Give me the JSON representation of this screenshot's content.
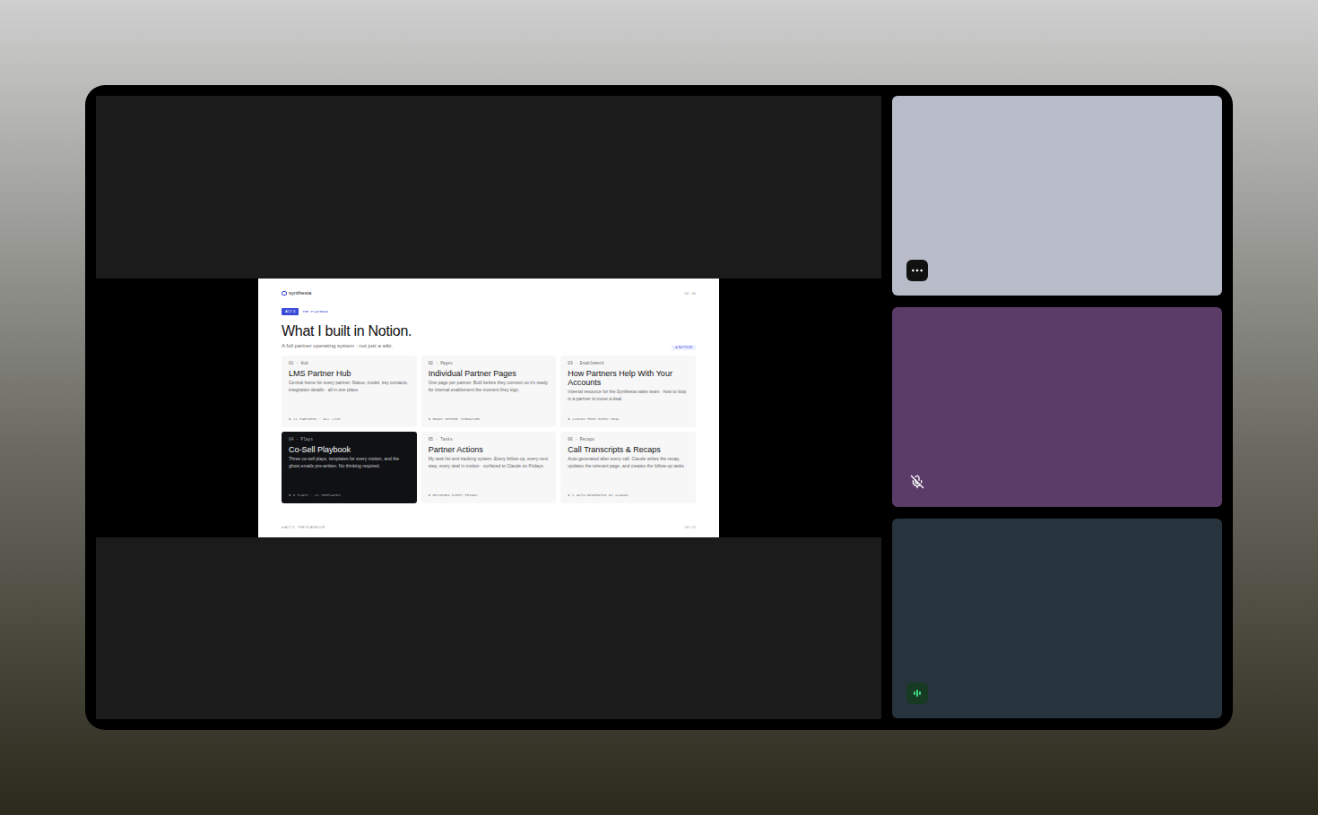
{
  "slide": {
    "logo": "synthesia",
    "nav": "04 · 06",
    "badge": "ACT 4",
    "section": "THE PLAYBOOK",
    "title": "What I built in Notion.",
    "subtitle": "A full partner operating system · not just a wiki.",
    "tag": "● NOTION",
    "cards": [
      {
        "eyebrow": "01 · Hub",
        "title": "LMS Partner Hub",
        "body": "Central home for every partner. Status, model, key contacts, integration details · all in one place.",
        "footer": "● 11 PARTNERS · ALL LIVE",
        "highlighted": false
      },
      {
        "eyebrow": "02 · Pages",
        "title": "Individual Partner Pages",
        "body": "One page per partner. Built before they connect so it's ready for internal enablement the moment they sign.",
        "footer": "● READY BEFORE SIGNATURE",
        "highlighted": false
      },
      {
        "eyebrow": "03 · Enablement",
        "title": "How Partners Help With Your Accounts",
        "body": "Internal resource for the Synthesia sales team · how to loop in a partner to move a deal.",
        "footer": "● LINKED FROM EVERY DEAL",
        "highlighted": false
      },
      {
        "eyebrow": "04 · Plays",
        "title": "Co-Sell Playbook",
        "body": "Three co-sell plays, templates for every motion, and the ghost emails pre-written. No thinking required.",
        "footer": "● 3 PLAYS · 12 TEMPLATES",
        "highlighted": true
      },
      {
        "eyebrow": "05 · Tasks",
        "title": "Partner Actions",
        "body": "My task list and tracking system. Every follow-up, every next step, every deal in motion · surfaced to Claude on Fridays.",
        "footer": "● REVIEWED EVERY FRIDAY",
        "highlighted": false
      },
      {
        "eyebrow": "06 · Recaps",
        "title": "Call Transcripts & Recaps",
        "body": "Auto-generated after every call. Claude writes the recap, updates the relevant page, and creates the follow-up tasks.",
        "footer": "● ↳ AUTO-GENERATED BY CLAUDE",
        "highlighted": false
      }
    ],
    "footer_left": "● ACT 4 · THE PLAYBOOK",
    "footer_right": "09 / 12"
  },
  "participants": [
    {
      "kind": "menu"
    },
    {
      "kind": "muted"
    },
    {
      "kind": "speaking"
    }
  ]
}
